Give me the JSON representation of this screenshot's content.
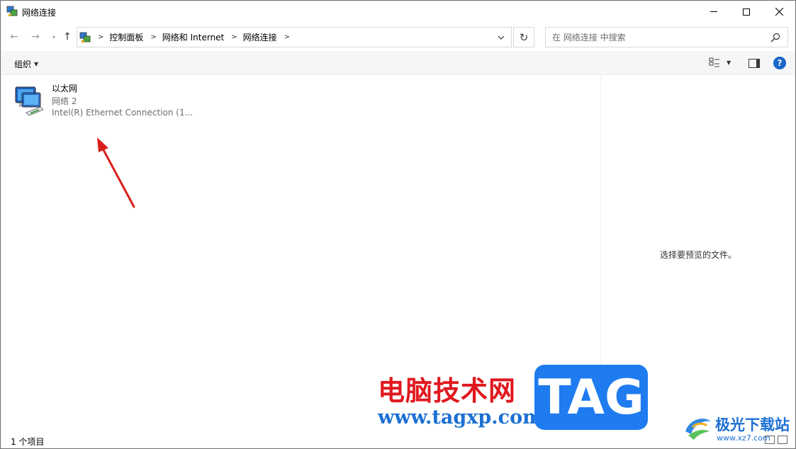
{
  "window": {
    "title": "网络连接"
  },
  "address": {
    "breadcrumbs": [
      "控制面板",
      "网络和 Internet",
      "网络连接"
    ],
    "search_placeholder": "在 网络连接 中搜索"
  },
  "toolbar": {
    "organize_label": "组织",
    "help_label": "?"
  },
  "items": [
    {
      "name": "以太网",
      "network": "网络 2",
      "adapter": "Intel(R) Ethernet Connection (1..."
    }
  ],
  "preview": {
    "empty_text": "选择要预览的文件。"
  },
  "status": {
    "item_count": "1 个项目"
  },
  "watermark": {
    "site_cn": "电脑技术网",
    "site_url": "www.tagxp.com",
    "tag": "TAG",
    "logo_cn": "极光下载站",
    "logo_url": "www.xz7.com"
  },
  "colors": {
    "annotation_arrow": "#d8201c",
    "help_blue": "#1a66c9"
  }
}
